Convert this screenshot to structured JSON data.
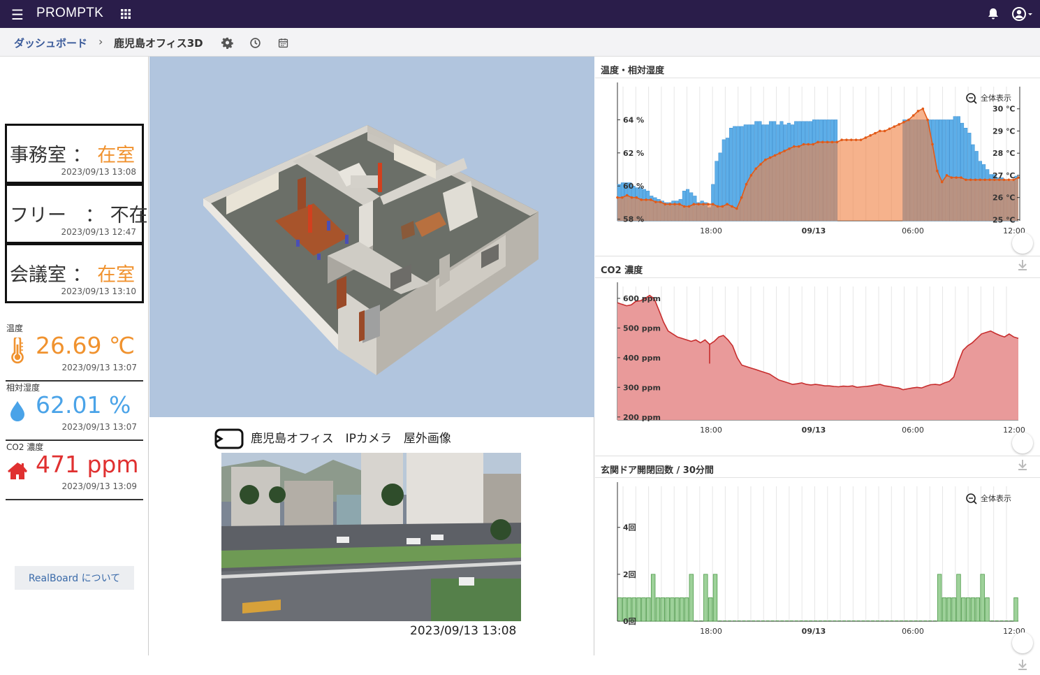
{
  "topbar": {
    "brand": "PROMPTK"
  },
  "breadcrumb": {
    "home": "ダッシュボード",
    "separator": "›",
    "current": "鹿児島オフィス3D"
  },
  "rooms": [
    {
      "name": "事務室 ：",
      "status": "在室",
      "time": "2023/09/13 13:08",
      "status_color": "#f0922e"
    },
    {
      "name": "フリー　：",
      "status": "不在",
      "time": "2023/09/13 12:47",
      "status_color": "#333333"
    },
    {
      "name": "会議室 ：",
      "status": "在室",
      "time": "2023/09/13 13:10",
      "status_color": "#f0922e"
    }
  ],
  "sensors": [
    {
      "label": "温度",
      "value": "26.69 ℃",
      "time": "2023/09/13 13:07",
      "color": "#f0922e",
      "icon": "thermometer-icon"
    },
    {
      "label": "相対湿度",
      "value": "62.01 %",
      "time": "2023/09/13 13:07",
      "color": "#4aa3e8",
      "icon": "water-drop-icon"
    },
    {
      "label": "CO2 濃度",
      "value": "471 ppm",
      "time": "2023/09/13 13:09",
      "color": "#e03030",
      "icon": "house-icon"
    }
  ],
  "about_button": "RealBoard について",
  "camera": {
    "title": "鹿児島オフィス　IPカメラ　屋外画像",
    "timestamp": "2023/09/13 13:08"
  },
  "x_ticks": [
    "18:00",
    "09/13",
    "06:00",
    "12:00"
  ],
  "panels": {
    "humidity_temp": {
      "title": "温度・相対湿度",
      "zoom_label": "全体表示",
      "chart_data": {
        "type": "bar",
        "y_left_ticks": [
          "58 %",
          "60 %",
          "62 %",
          "64 %"
        ],
        "y_right_ticks": [
          "25 ℃",
          "26 ℃",
          "27 ℃",
          "28 ℃",
          "29 ℃",
          "30 ℃"
        ],
        "humidity_bars": [
          60.1,
          60.2,
          60.2,
          60.2,
          60.0,
          59.9,
          59.9,
          59.8,
          59.7,
          59.4,
          59.3,
          59.2,
          59.1,
          59.0,
          59.0,
          59.1,
          59.1,
          59.2,
          59.7,
          59.8,
          59.6,
          59.4,
          59.0,
          59.1,
          59.0,
          58.7,
          60.1,
          61.5,
          62.0,
          62.8,
          62.9,
          63.5,
          63.6,
          63.6,
          63.6,
          63.7,
          63.7,
          63.7,
          63.9,
          63.9,
          63.7,
          63.7,
          63.9,
          63.9,
          63.7,
          63.9,
          63.7,
          63.8,
          63.7,
          63.9,
          63.9,
          63.9,
          63.9,
          63.9,
          64.0,
          64.0,
          64.0,
          64.0,
          64.0,
          64.0,
          64.0,
          64.0,
          64.0,
          64.0,
          64.0,
          64.0,
          64.0,
          64.0,
          64.0,
          64.0,
          64.0,
          64.0,
          64.0,
          64.0,
          64.0,
          64.0,
          64.0,
          64.0,
          64.0,
          64.0,
          64.0,
          64.0,
          64.0,
          64.0,
          64.0,
          64.0,
          64.0,
          64.0,
          64.0,
          64.0,
          64.0,
          64.0,
          64.0,
          64.2,
          64.2,
          63.8,
          63.5,
          63.2,
          62.5,
          62.1,
          61.5,
          61.3,
          61.0,
          60.7,
          60.7,
          60.5,
          60.5,
          60.4,
          60.3,
          60.3,
          60.6
        ],
        "temperature_c": [
          26.0,
          26.0,
          26.1,
          26.0,
          26.0,
          25.9,
          25.9,
          25.9,
          25.8,
          25.8,
          25.7,
          25.7,
          25.7,
          25.7,
          25.6,
          25.6,
          25.7,
          25.7,
          25.7,
          25.7,
          25.7,
          25.6,
          25.6,
          25.7,
          25.6,
          25.5,
          26.0,
          26.6,
          27.0,
          27.3,
          27.5,
          27.7,
          27.8,
          27.9,
          28.0,
          28.1,
          28.2,
          28.3,
          28.3,
          28.4,
          28.4,
          28.4,
          28.5,
          28.5,
          28.5,
          28.5,
          28.5,
          28.6,
          28.6,
          28.6,
          28.6,
          28.6,
          28.7,
          28.8,
          28.9,
          29.0,
          29.0,
          29.1,
          29.2,
          29.3,
          29.4,
          29.5,
          29.7,
          29.9,
          30.0,
          29.5,
          28.4,
          27.2,
          26.7,
          27.0,
          26.9,
          26.9,
          26.9,
          26.8,
          26.8,
          26.8,
          26.8,
          26.8,
          26.8,
          26.8,
          26.8,
          26.8,
          26.8,
          26.8,
          26.9
        ]
      }
    },
    "co2": {
      "title": "CO2 濃度",
      "chart_data": {
        "type": "area",
        "y_ticks": [
          "200 ppm",
          "300 ppm",
          "400 ppm",
          "500 ppm",
          "600 ppm"
        ],
        "values": [
          585,
          580,
          575,
          578,
          590,
          592,
          600,
          610,
          598,
          560,
          520,
          490,
          480,
          470,
          465,
          460,
          455,
          460,
          450,
          460,
          445,
          455,
          470,
          475,
          460,
          440,
          400,
          375,
          370,
          365,
          360,
          355,
          350,
          345,
          335,
          325,
          320,
          315,
          310,
          312,
          315,
          310,
          308,
          310,
          308,
          305,
          305,
          303,
          302,
          304,
          303,
          305,
          300,
          302,
          303,
          305,
          308,
          310,
          305,
          303,
          300,
          298,
          292,
          295,
          298,
          300,
          298,
          304,
          309,
          310,
          308,
          315,
          320,
          335,
          385,
          425,
          440,
          450,
          465,
          480,
          485,
          490,
          482,
          475,
          470,
          480,
          470,
          465
        ]
      }
    },
    "door": {
      "title": "玄関ドア開閉回数 / 30分間",
      "zoom_label": "全体表示",
      "chart_data": {
        "type": "bar",
        "y_ticks": [
          "0回",
          "2回",
          "4回"
        ],
        "values": [
          1,
          1,
          1,
          1,
          1,
          1,
          1,
          2,
          1,
          1,
          1,
          1,
          1,
          1,
          1,
          2,
          0,
          0,
          2,
          1,
          2,
          0,
          0,
          0,
          0,
          0,
          0,
          0,
          0,
          0,
          0,
          0,
          0,
          0,
          0,
          0,
          0,
          0,
          0,
          0,
          0,
          0,
          0,
          0,
          0,
          0,
          0,
          0,
          0,
          0,
          0,
          0,
          0,
          0,
          0,
          0,
          0,
          0,
          0,
          0,
          0,
          0,
          0,
          0,
          0,
          0,
          0,
          2,
          1,
          1,
          1,
          2,
          1,
          1,
          1,
          1,
          2,
          1,
          0,
          0,
          0,
          0,
          0,
          1
        ]
      }
    }
  }
}
